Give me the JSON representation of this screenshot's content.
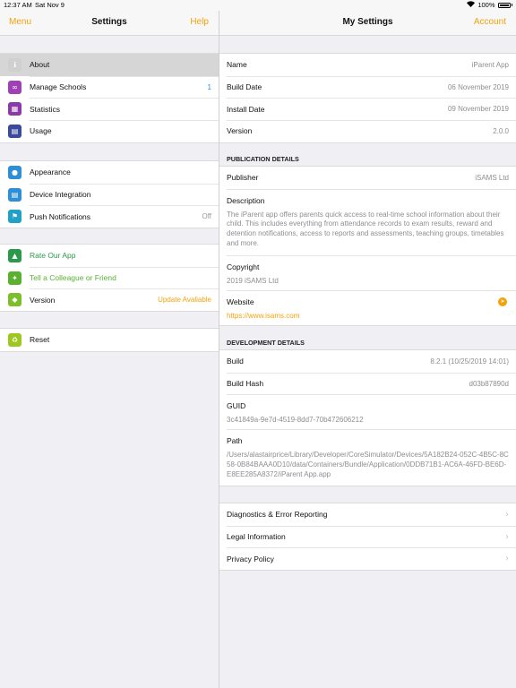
{
  "status": {
    "time": "12:37 AM",
    "date": "Sat Nov 9",
    "battery": "100%"
  },
  "left_nav": {
    "menu": "Menu",
    "title": "Settings",
    "help": "Help"
  },
  "right_nav": {
    "title": "My Settings",
    "account": "Account"
  },
  "left_groups": [
    [
      {
        "label": "About",
        "icon": "info-icon",
        "color": "#d0d0d0",
        "value": ""
      },
      {
        "label": "Manage Schools",
        "icon": "link-icon",
        "color": "#a040b5",
        "value": "1"
      },
      {
        "label": "Statistics",
        "icon": "presentation-icon",
        "color": "#8b3aa8",
        "value": ""
      },
      {
        "label": "Usage",
        "icon": "bar-chart-icon",
        "color": "#3a4a9c",
        "value": ""
      }
    ],
    [
      {
        "label": "Appearance",
        "icon": "palette-icon",
        "color": "#2f8fd6",
        "value": ""
      },
      {
        "label": "Device Integration",
        "icon": "calculator-icon",
        "color": "#2f8fd6",
        "value": ""
      },
      {
        "label": "Push Notifications",
        "icon": "flag-icon",
        "color": "#22a0c8",
        "value": "Off"
      }
    ],
    [
      {
        "label": "Rate Our App",
        "icon": "thumbs-up-icon",
        "color": "#2a9a4a",
        "value": ""
      },
      {
        "label": "Tell a Colleague or Friend",
        "icon": "share-icon",
        "color": "#5ab030",
        "value": ""
      },
      {
        "label": "Version",
        "icon": "tag-icon",
        "color": "#7cbf2a",
        "value": "Update Avaliable"
      }
    ],
    [
      {
        "label": "Reset",
        "icon": "recycle-icon",
        "color": "#9cc820",
        "value": ""
      }
    ]
  ],
  "info": [
    {
      "label": "Name",
      "value": "iParent App"
    },
    {
      "label": "Build Date",
      "value": "06 November 2019"
    },
    {
      "label": "Install Date",
      "value": "09 November 2019"
    },
    {
      "label": "Version",
      "value": "2.0.0"
    }
  ],
  "publication": {
    "header": "PUBLICATION DETAILS",
    "publisher_label": "Publisher",
    "publisher_value": "iSAMS Ltd",
    "description_label": "Description",
    "description_text": "The iParent app offers parents quick access to real-time school information about their child. This includes everything from attendance records to exam results, reward and detention notifications, access to reports and assessments, teaching groups, timetables and more.",
    "copyright_label": "Copyright",
    "copyright_value": "2019 iSAMS Ltd",
    "website_label": "Website",
    "website_value": "https://www.isams.com"
  },
  "development": {
    "header": "DEVELOPMENT DETAILS",
    "build_label": "Build",
    "build_value": "8.2.1 (10/25/2019 14:01)",
    "hash_label": "Build Hash",
    "hash_value": "d03b87890d",
    "guid_label": "GUID",
    "guid_value": "3c41849a-9e7d-4519-8dd7-70b472606212",
    "path_label": "Path",
    "path_value": "/Users/alastairprice/Library/Developer/CoreSimulator/Devices/5A182B24-052C-4B5C-8C58-0B84BAAA0D10/data/Containers/Bundle/Application/0DDB71B1-AC6A-46FD-BE6D-E8EE285A8372/iParent App.app"
  },
  "links": [
    "Diagnostics & Error Reporting",
    "Legal Information",
    "Privacy Policy"
  ]
}
